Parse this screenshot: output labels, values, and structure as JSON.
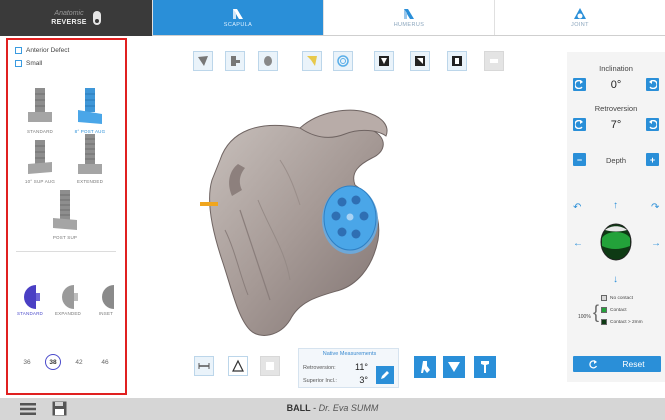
{
  "header": {
    "mode": {
      "subtitle": "Anatomic",
      "title": "REVERSE"
    },
    "tabs": [
      {
        "label": "SCAPULA",
        "active": true
      },
      {
        "label": "HUMERUS",
        "active": false
      },
      {
        "label": "JOINT",
        "active": false
      }
    ]
  },
  "left_panel": {
    "checkboxes": [
      {
        "label": "Anterior Defect",
        "checked": false
      },
      {
        "label": "Small",
        "checked": false
      }
    ],
    "implants": [
      {
        "label": "STANDARD",
        "selected": false
      },
      {
        "label": "8° POST AUG",
        "selected": true
      },
      {
        "label": "10° SUP AUG",
        "selected": false
      },
      {
        "label": "EXTENDED",
        "selected": false
      },
      {
        "label": "POST SUP",
        "selected": false
      }
    ],
    "glenospheres": [
      {
        "label": "STANDARD",
        "selected": true
      },
      {
        "label": "EXPANDED",
        "selected": false
      },
      {
        "label": "INSET",
        "selected": false
      }
    ],
    "sizes": [
      "36",
      "38",
      "42",
      "46"
    ],
    "selected_size": "38"
  },
  "measurements": {
    "title": "Native Measurements",
    "retroversion_label": "Retroversion:",
    "retroversion_value": "11°",
    "inclination_label": "Superior Incl.:",
    "inclination_value": "3°"
  },
  "right_panel": {
    "inclination_label": "Inclination",
    "inclination_value": "0°",
    "retroversion_label": "Retroversion",
    "retroversion_value": "7°",
    "depth_label": "Depth",
    "legend_percent": "100%",
    "legend": [
      {
        "label": "No contact",
        "color": "#d8d8d8"
      },
      {
        "label": "Contact",
        "color": "#23a23a"
      },
      {
        "label": "Contact > 2mm",
        "color": "#0e3a14"
      }
    ],
    "reset_label": "Reset"
  },
  "footer": {
    "title": "BALL",
    "separator": " - ",
    "doctor": "Dr. Eva SUMM"
  },
  "colors": {
    "accent": "#2a8fd8",
    "highlight_border": "#e02020",
    "implant_blue": "#4aa6e8"
  }
}
